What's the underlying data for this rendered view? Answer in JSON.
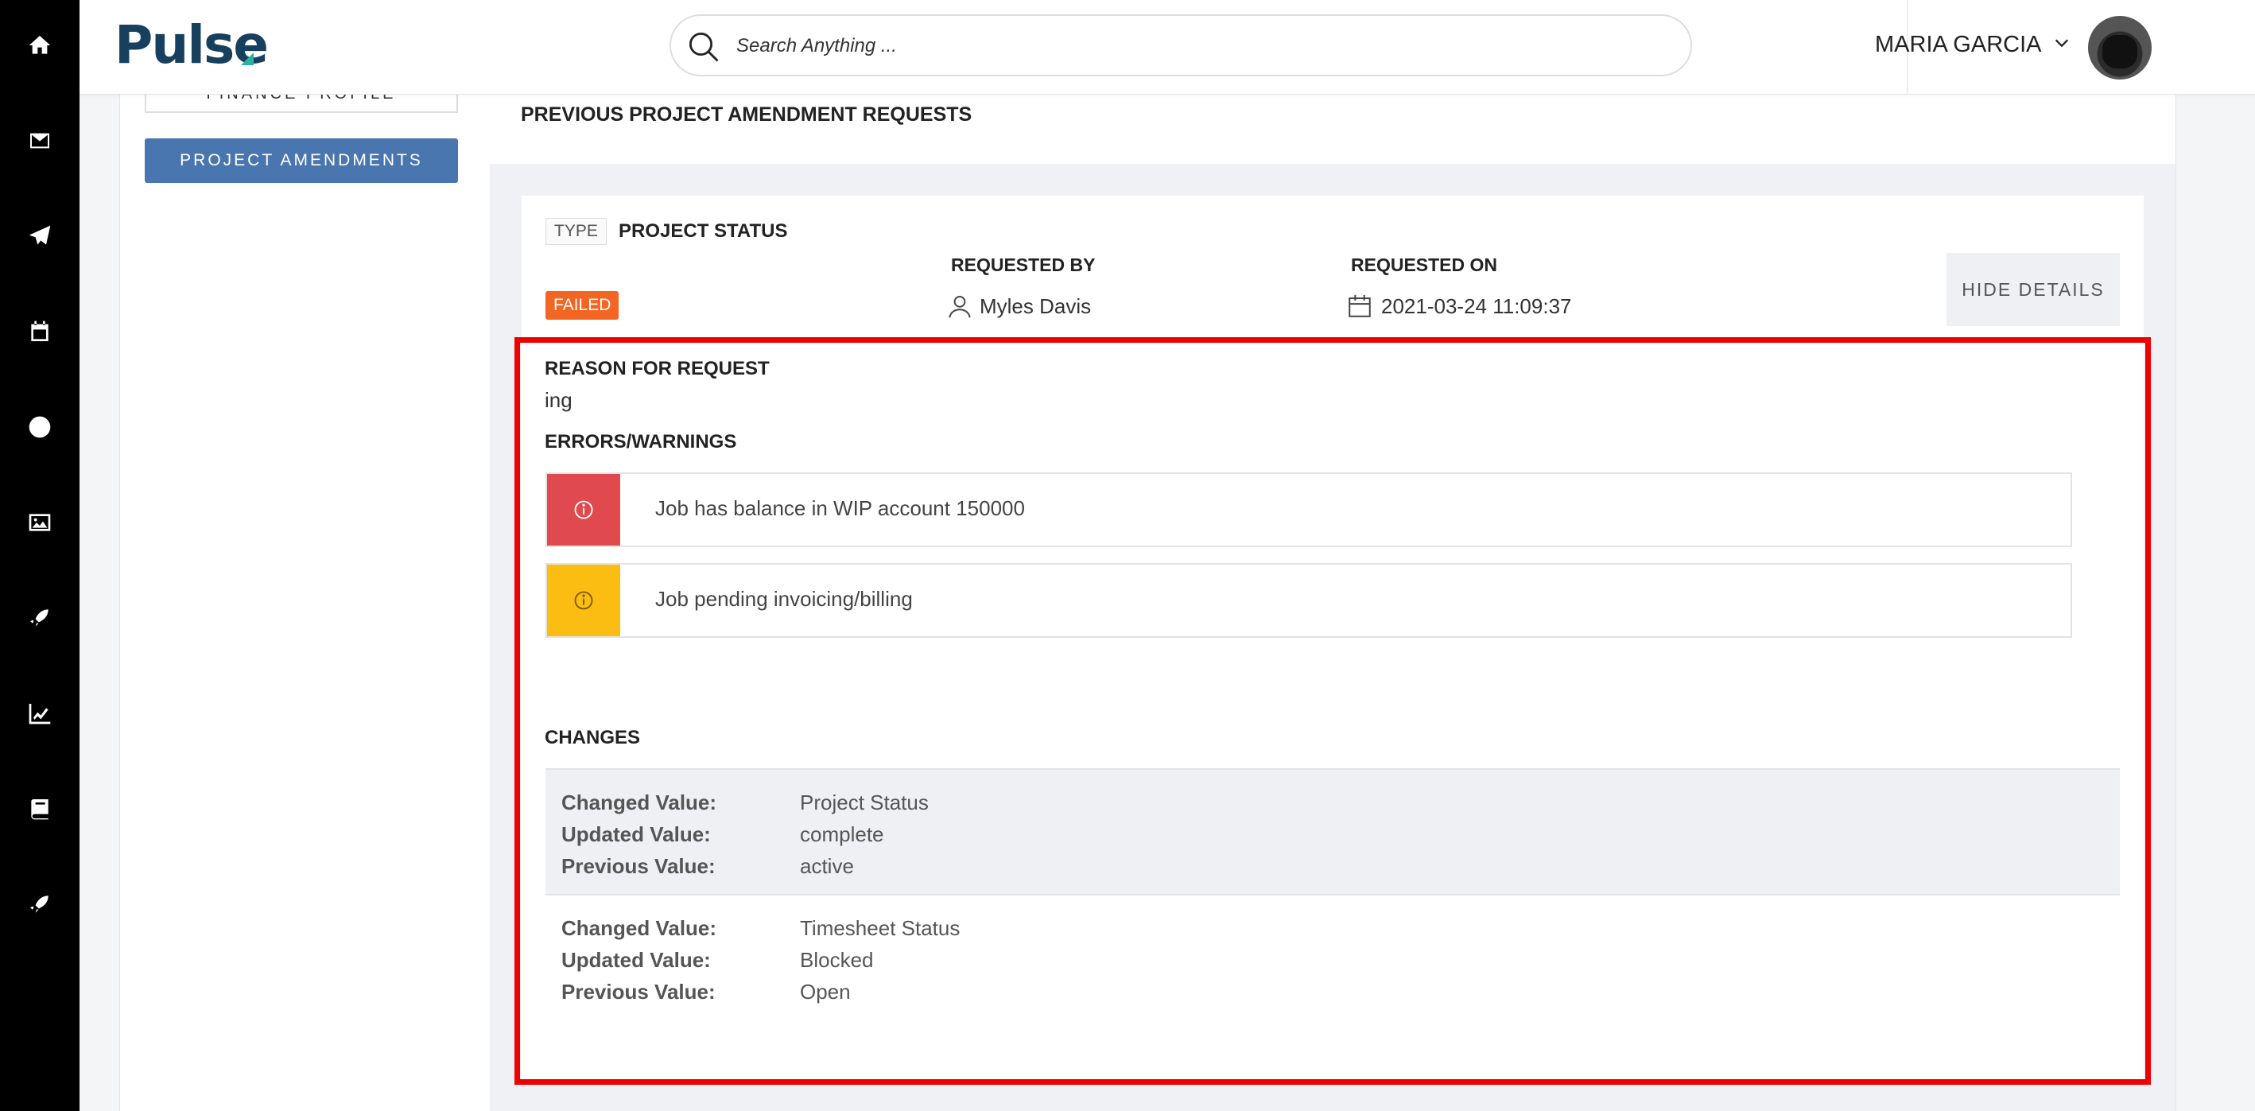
{
  "header": {
    "logo": "Pulse",
    "search_placeholder": "Search Anything ...",
    "user_name": "MARIA GARCIA"
  },
  "rail": {
    "icons": [
      "home-icon",
      "mail-icon",
      "send-icon",
      "calendar-icon",
      "clock-icon",
      "image-icon",
      "rocket-icon",
      "chart-icon",
      "book-icon",
      "rocket-icon-2"
    ]
  },
  "sidebar": {
    "finance_profile": "FINANCE PROFILE",
    "project_amendments": "PROJECT AMENDMENTS"
  },
  "main": {
    "section_title": "PREVIOUS PROJECT AMENDMENT REQUESTS",
    "request": {
      "type_label": "TYPE",
      "type_value": "PROJECT STATUS",
      "status": "FAILED",
      "status_color": "#f26522",
      "requested_by_label": "REQUESTED BY",
      "requested_by": "Myles Davis",
      "requested_on_label": "REQUESTED ON",
      "requested_on": "2021-03-24 11:09:37",
      "hide_details": "HIDE DETAILS",
      "reason_title": "REASON FOR REQUEST",
      "reason_text": "ing",
      "errors_title": "ERRORS/WARNINGS",
      "alerts": [
        {
          "level": "error",
          "color": "#e04a4f",
          "text": "Job has balance in WIP account 150000"
        },
        {
          "level": "warning",
          "color": "#fbbd12",
          "text": "Job pending invoicing/billing"
        }
      ],
      "changes_title": "CHANGES",
      "changes": [
        {
          "changed_label": "Changed Value:",
          "changed": "Project Status",
          "updated_label": "Updated Value:",
          "updated": "complete",
          "previous_label": "Previous Value:",
          "previous": "active"
        },
        {
          "changed_label": "Changed Value:",
          "changed": "Timesheet Status",
          "updated_label": "Updated Value:",
          "updated": "Blocked",
          "previous_label": "Previous Value:",
          "previous": "Open"
        }
      ]
    }
  },
  "colors": {
    "accent_button": "#4a76b0",
    "highlight_box": "#ee0000",
    "logo": "#17405e"
  }
}
